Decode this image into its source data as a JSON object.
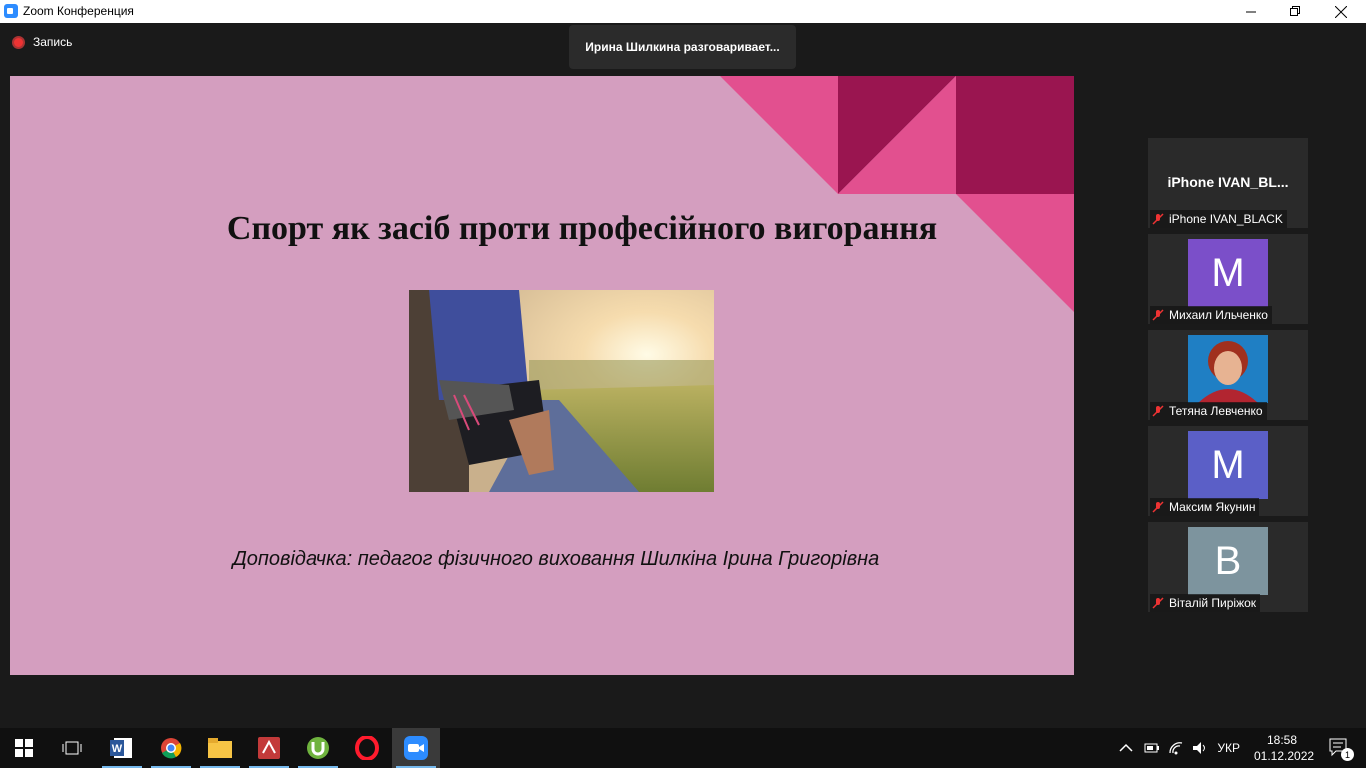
{
  "window": {
    "title": "Zoom Конференция"
  },
  "zoom": {
    "recording_label": "Запись",
    "speaker_toast": "Ирина Шилкина разговаривает..."
  },
  "slide": {
    "title": "Спорт як засіб проти професійного вигорання",
    "subtitle": "Доповідачка: педагог фізичного виховання Шилкіна Ірина Григорівна"
  },
  "participants": [
    {
      "tile_name": "iPhone  IVAN_BL...",
      "label": "iPhone IVAN_BLACK"
    },
    {
      "initial": "M",
      "color": "#7b4fc9",
      "label": "Михаил Ильченко"
    },
    {
      "label": "Тетяна Левченко"
    },
    {
      "initial": "M",
      "color": "#5b5fc7",
      "label": "Максим Якунин"
    },
    {
      "initial": "B",
      "color": "#7d949e",
      "label": "Віталій Пиріжок"
    }
  ],
  "taskbar": {
    "lang": "УКР",
    "time": "18:58",
    "date": "01.12.2022",
    "notif_count": "1"
  },
  "colors": {
    "slide_bg": "#d49ebf",
    "accent_pink": "#e2508f",
    "accent_dark": "#9a1550"
  }
}
